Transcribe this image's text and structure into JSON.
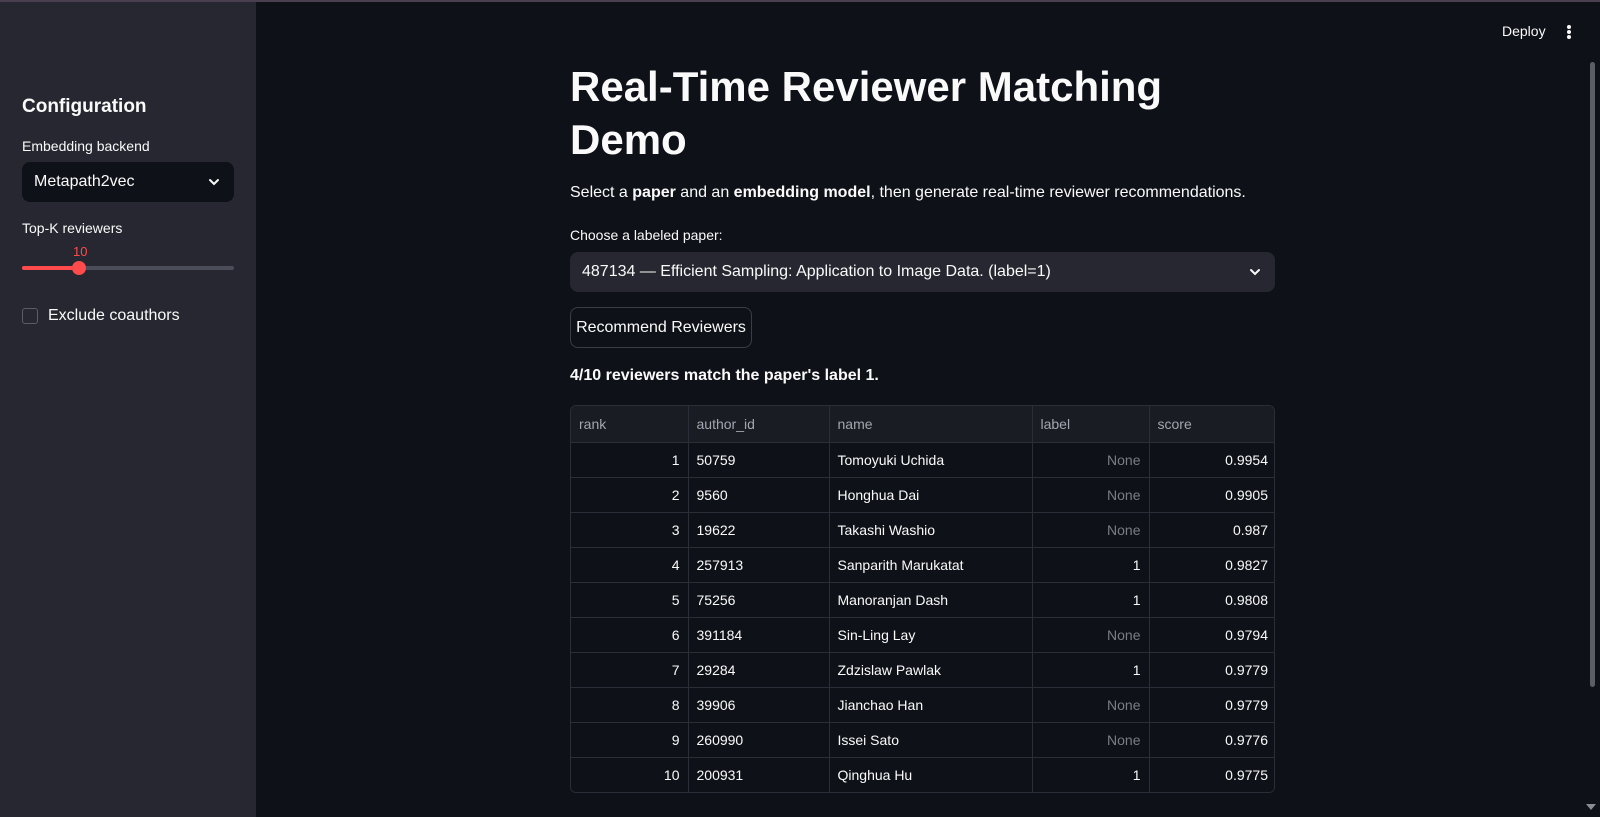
{
  "sidebar": {
    "title": "Configuration",
    "backend_label": "Embedding backend",
    "backend_value": "Metapath2vec",
    "topk_label": "Top-K reviewers",
    "topk_value": "10",
    "topk_fraction": 0.27,
    "exclude_label": "Exclude coauthors",
    "exclude_checked": false
  },
  "header": {
    "deploy_label": "Deploy"
  },
  "main": {
    "title": "Real-Time Reviewer Matching Demo",
    "intro_parts": [
      "Select a ",
      "paper",
      " and an ",
      "embedding model",
      ", then generate real-time reviewer recommendations."
    ],
    "choose_label": "Choose a labeled paper:",
    "paper_value": "487134 — Efficient Sampling: Application to Image Data. (label=1)",
    "button_label": "Recommend Reviewers",
    "result_text": "4/10 reviewers match the paper's label 1."
  },
  "table": {
    "columns": [
      "rank",
      "author_id",
      "name",
      "label",
      "score"
    ],
    "rows": [
      [
        "1",
        "50759",
        "Tomoyuki Uchida",
        "None",
        "0.9954"
      ],
      [
        "2",
        "9560",
        "Honghua Dai",
        "None",
        "0.9905"
      ],
      [
        "3",
        "19622",
        "Takashi Washio",
        "None",
        "0.987"
      ],
      [
        "4",
        "257913",
        "Sanparith Marukatat",
        "1",
        "0.9827"
      ],
      [
        "5",
        "75256",
        "Manoranjan Dash",
        "1",
        "0.9808"
      ],
      [
        "6",
        "391184",
        "Sin-Ling Lay",
        "None",
        "0.9794"
      ],
      [
        "7",
        "29284",
        "Zdzislaw Pawlak",
        "1",
        "0.9779"
      ],
      [
        "8",
        "39906",
        "Jianchao Han",
        "None",
        "0.9779"
      ],
      [
        "9",
        "260990",
        "Issei Sato",
        "None",
        "0.9776"
      ],
      [
        "10",
        "200931",
        "Qinghua Hu",
        "1",
        "0.9775"
      ]
    ]
  },
  "colors": {
    "accent": "#ff4b4b",
    "background": "#0e1117",
    "sidebar": "#262730"
  }
}
